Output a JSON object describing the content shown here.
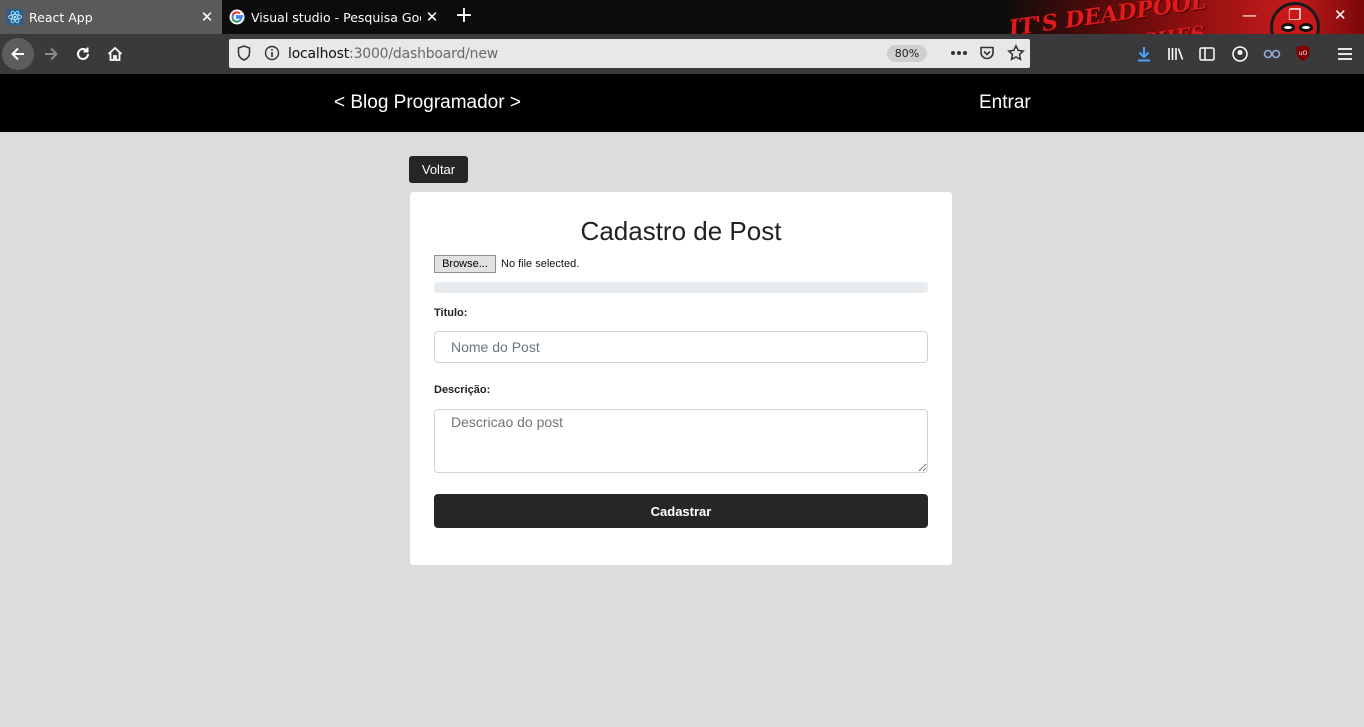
{
  "browser": {
    "tabs": [
      {
        "title": "React App",
        "icon": "react-icon",
        "active": true
      },
      {
        "title": "Visual studio - Pesquisa Google",
        "icon": "google-icon",
        "active": false
      }
    ],
    "url": {
      "host": "localhost",
      "rest": ":3000/dashboard/new"
    },
    "zoom": "80%",
    "theme_text": [
      "IT'S DEADPOOL",
      "BITCHES"
    ]
  },
  "header": {
    "brand": "< Blog Programador >",
    "login_label": "Entrar"
  },
  "page": {
    "back_label": "Voltar",
    "title": "Cadastro de Post",
    "file": {
      "button_label": "Browse...",
      "status": "No file selected."
    },
    "upload_progress": 0,
    "title_field": {
      "label": "Titulo:",
      "placeholder": "Nome do Post",
      "value": ""
    },
    "description_field": {
      "label": "Descrição:",
      "placeholder": "Descricao do post",
      "value": ""
    },
    "submit_label": "Cadastrar"
  },
  "colors": {
    "page_bg": "#dcdcdc",
    "header_bg": "#000000",
    "button_bg": "#262626",
    "card_bg": "#ffffff"
  }
}
